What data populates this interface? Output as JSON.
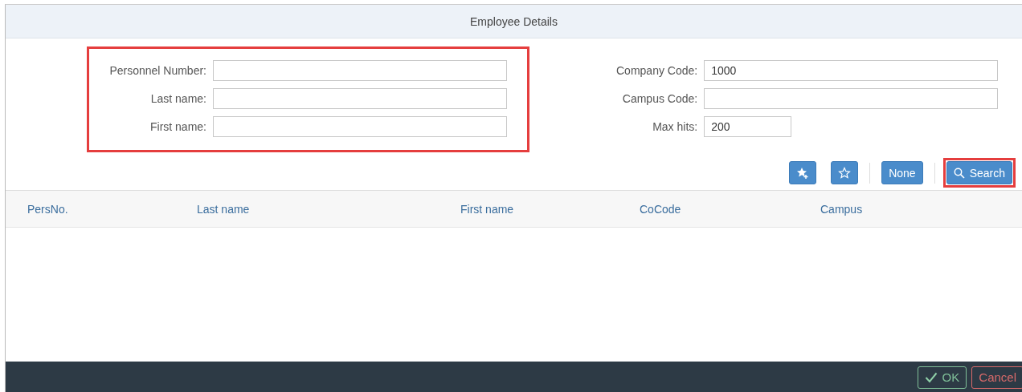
{
  "window": {
    "title": "Employee Details"
  },
  "left_fields": {
    "highlighted": true,
    "fields": [
      {
        "label": "Personnel Number:"
      },
      {
        "label": "Last name:"
      },
      {
        "label": "First name:"
      }
    ]
  },
  "right_fields": [
    {
      "label": "Company Code:",
      "value": "1000",
      "kind": "wide"
    },
    {
      "label": "Campus Code:",
      "kind": "wide"
    },
    {
      "label": "Max hits:",
      "value": "200",
      "kind": "short"
    }
  ],
  "toolbar": [
    {
      "kind": "star-plus",
      "highlighted": false
    },
    {
      "kind": "star",
      "highlighted": false
    },
    {
      "kind": "separator"
    },
    {
      "kind": "text",
      "label": "None",
      "highlighted": false
    },
    {
      "kind": "separator"
    },
    {
      "kind": "search",
      "label": "Search",
      "highlighted": true
    }
  ],
  "table": {
    "columns": [
      "PersNo.",
      "Last name",
      "First name",
      "CoCode",
      "Campus"
    ]
  },
  "footer": {
    "buttons": [
      {
        "kind": "ok",
        "label": "OK"
      },
      {
        "kind": "cancel",
        "label": "Cancel"
      }
    ]
  }
}
